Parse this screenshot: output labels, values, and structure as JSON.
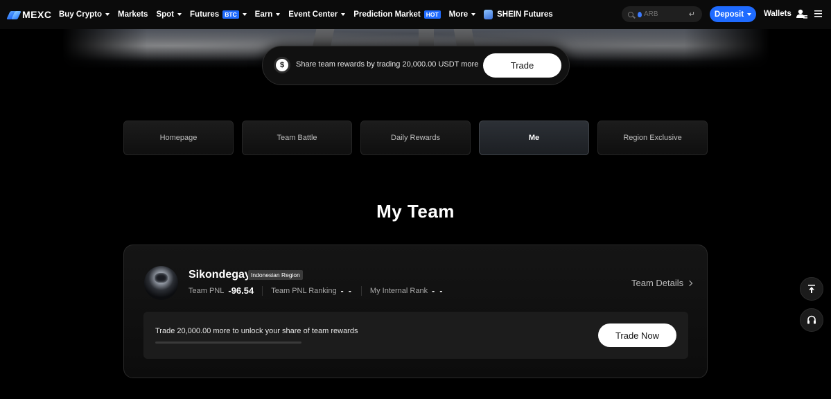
{
  "nav": {
    "logo_text": "MEXC",
    "items": [
      {
        "label": "Buy Crypto",
        "caret": true
      },
      {
        "label": "Markets",
        "caret": false
      },
      {
        "label": "Spot",
        "caret": true
      },
      {
        "label": "Futures",
        "tag": "BTC",
        "caret": true
      },
      {
        "label": "Earn",
        "caret": true
      },
      {
        "label": "Event Center",
        "caret": true
      },
      {
        "label": "Prediction Market",
        "tag": "HOT",
        "caret": false
      },
      {
        "label": "More",
        "caret": true
      },
      {
        "label": "SHEIN Futures",
        "caret": false
      }
    ],
    "search_placeholder": "ARB",
    "deposit_label": "Deposit",
    "wallets_label": "Wallets",
    "accent": "#1f6bff"
  },
  "promo": {
    "coin_symbol": "$",
    "text": "Share team rewards by trading 20,000.00 USDT more",
    "button_label": "Trade"
  },
  "tabs": [
    {
      "label": "Homepage",
      "active": false
    },
    {
      "label": "Team Battle",
      "active": false
    },
    {
      "label": "Daily Rewards",
      "active": false
    },
    {
      "label": "Me",
      "active": true
    },
    {
      "label": "Region Exclusive",
      "active": false
    }
  ],
  "section_title": "My Team",
  "team": {
    "username": "Sikondegay",
    "region_badge": "Indonesian Region",
    "pnl_label": "Team PNL",
    "pnl_value": "-96.54",
    "ranking_label": "Team PNL Ranking",
    "ranking_value": "- -",
    "internal_rank_label": "My Internal Rank",
    "internal_rank_value": "- -",
    "details_label": "Team Details",
    "unlock_text": "Trade 20,000.00 more to unlock your share of team rewards",
    "progress_fraction": 0,
    "trade_now_label": "Trade Now"
  }
}
